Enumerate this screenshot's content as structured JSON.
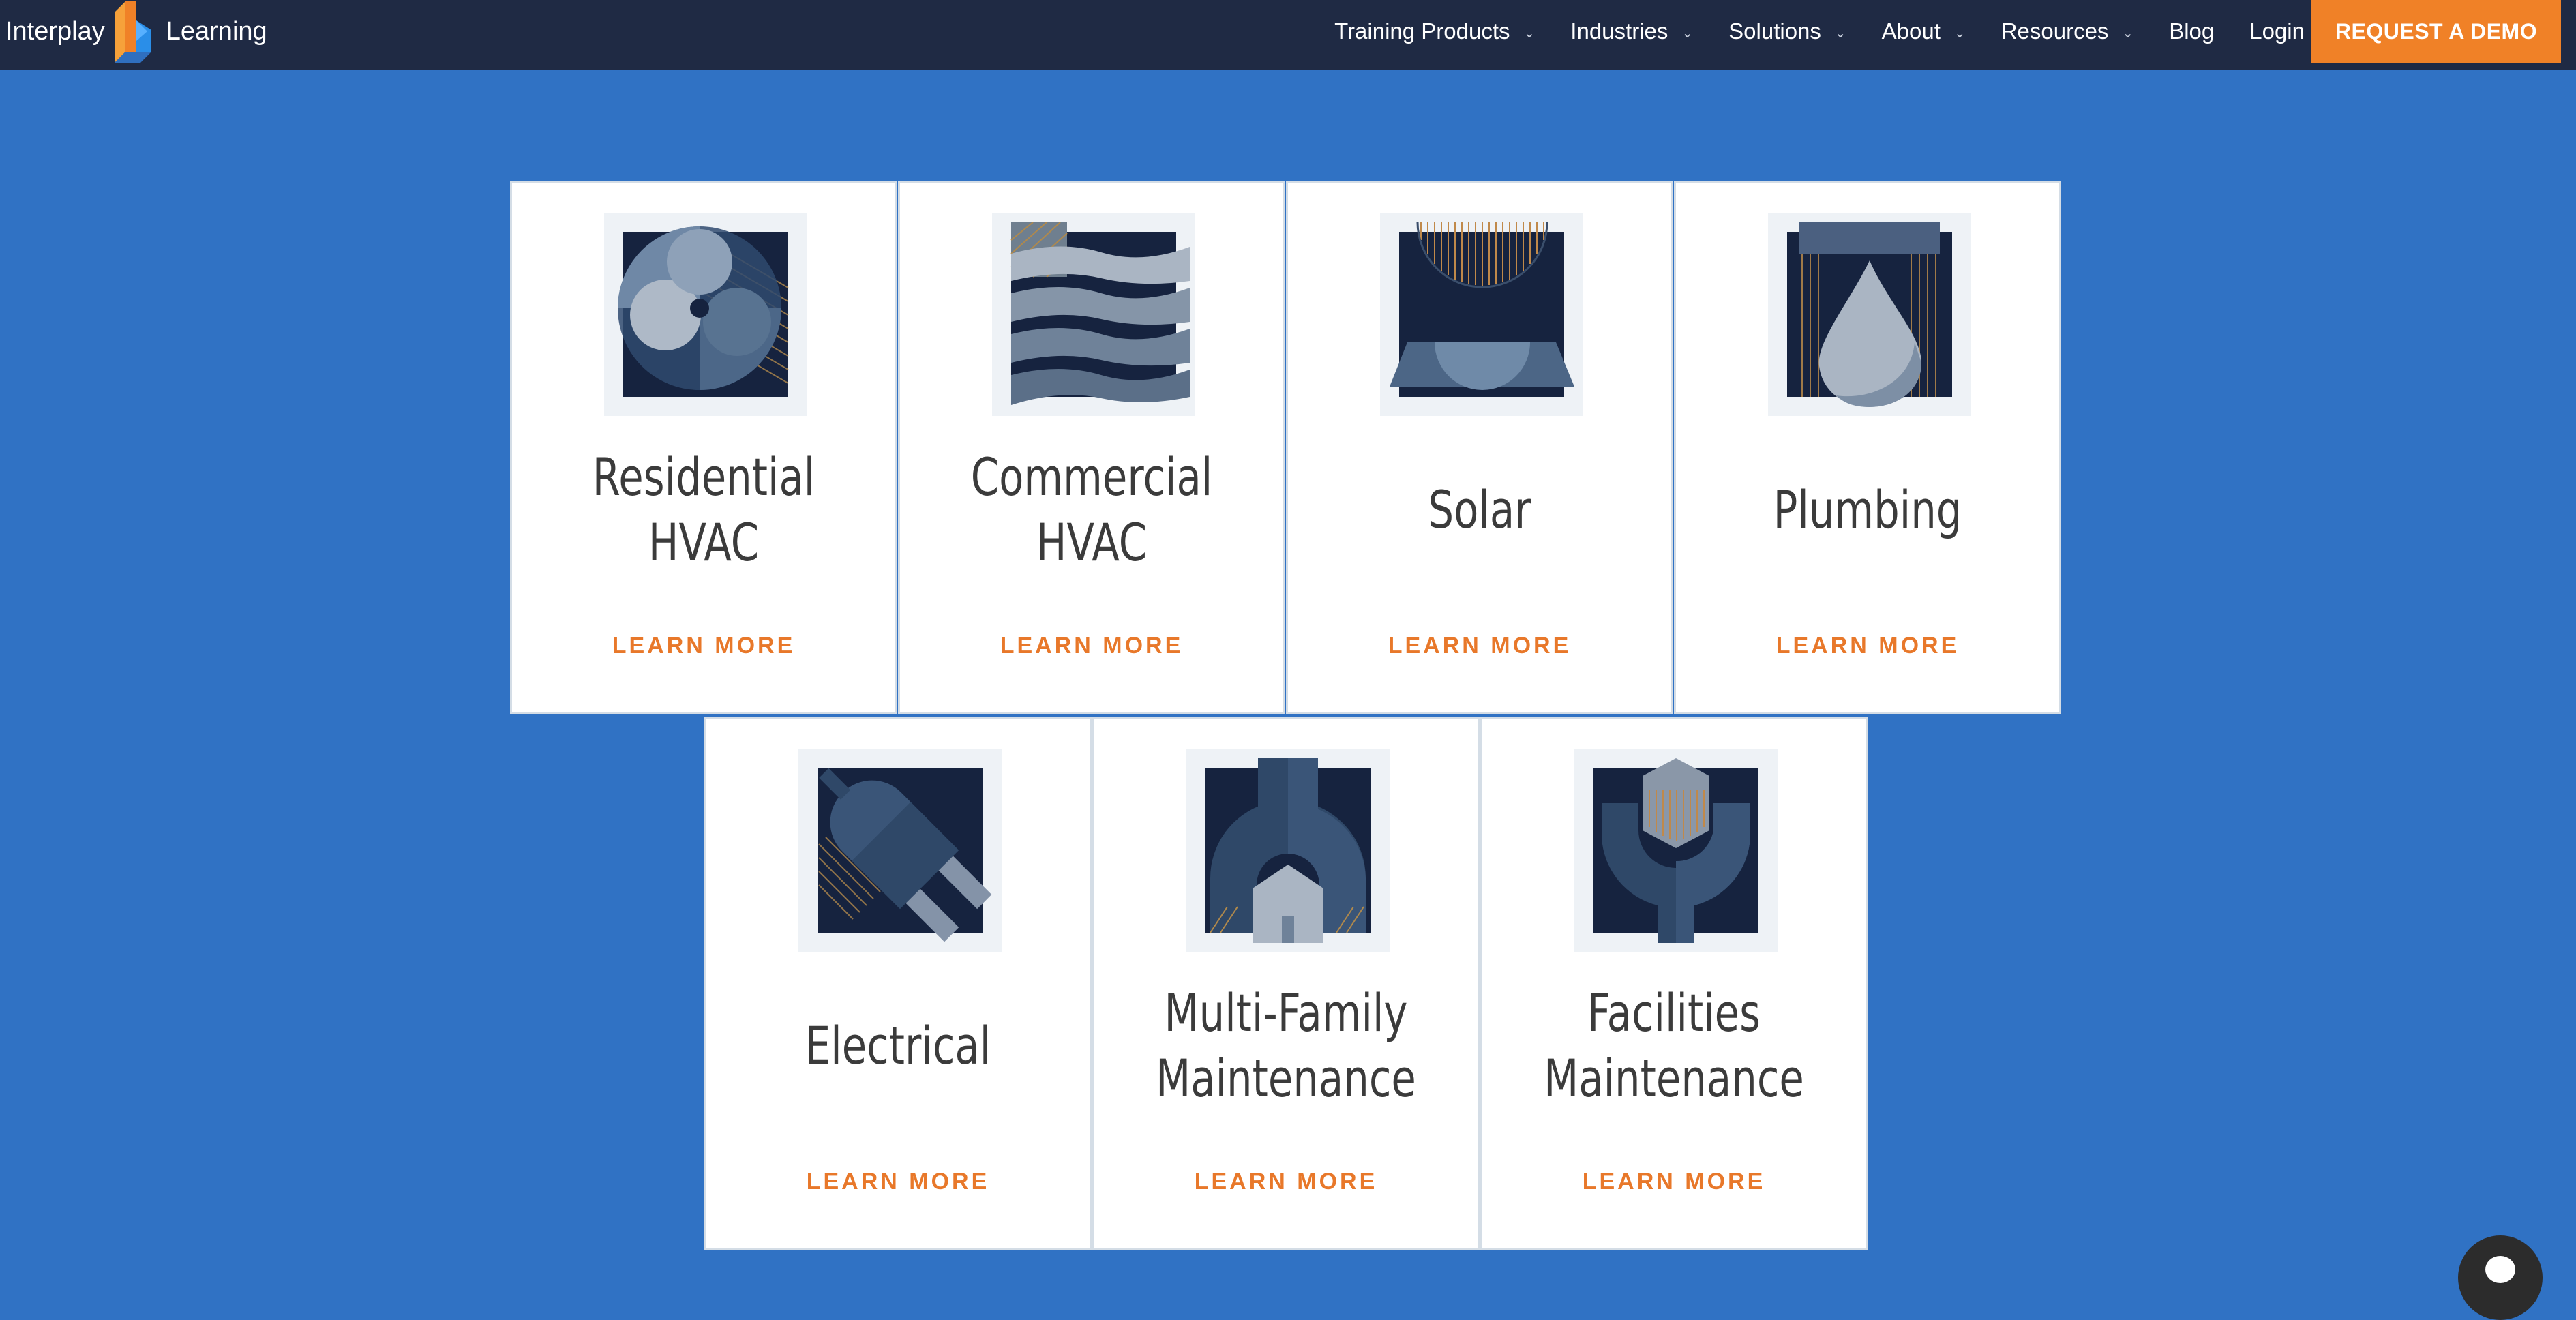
{
  "brand": {
    "name_left": "Interplay",
    "name_right": "Learning",
    "colors": {
      "navy": "#1f2a44",
      "blue": "#3072c4",
      "orange": "#f08127"
    }
  },
  "nav": {
    "items": [
      {
        "label": "Training Products",
        "has_dropdown": true
      },
      {
        "label": "Industries",
        "has_dropdown": true
      },
      {
        "label": "Solutions",
        "has_dropdown": true
      },
      {
        "label": "About",
        "has_dropdown": true
      },
      {
        "label": "Resources",
        "has_dropdown": true
      },
      {
        "label": "Blog",
        "has_dropdown": false
      },
      {
        "label": "Login",
        "has_dropdown": false
      }
    ],
    "chevron": "⌄",
    "cta": "REQUEST A DEMO"
  },
  "cards": [
    {
      "title": "Residential\nHVAC",
      "link": "LEARN MORE",
      "icon": "fan-icon"
    },
    {
      "title": "Commercial\nHVAC",
      "link": "LEARN MORE",
      "icon": "airflow-icon"
    },
    {
      "title": "Solar",
      "link": "LEARN MORE",
      "icon": "solar-icon"
    },
    {
      "title": "Plumbing",
      "link": "LEARN MORE",
      "icon": "water-drop-icon"
    },
    {
      "title": "Electrical",
      "link": "LEARN MORE",
      "icon": "plug-icon"
    },
    {
      "title": "Multi-Family\nMaintenance",
      "link": "LEARN MORE",
      "icon": "house-wrench-icon"
    },
    {
      "title": "Facilities\nMaintenance",
      "link": "LEARN MORE",
      "icon": "wrench-icon"
    }
  ],
  "chat": {
    "icon": "chat-bubble-icon"
  }
}
